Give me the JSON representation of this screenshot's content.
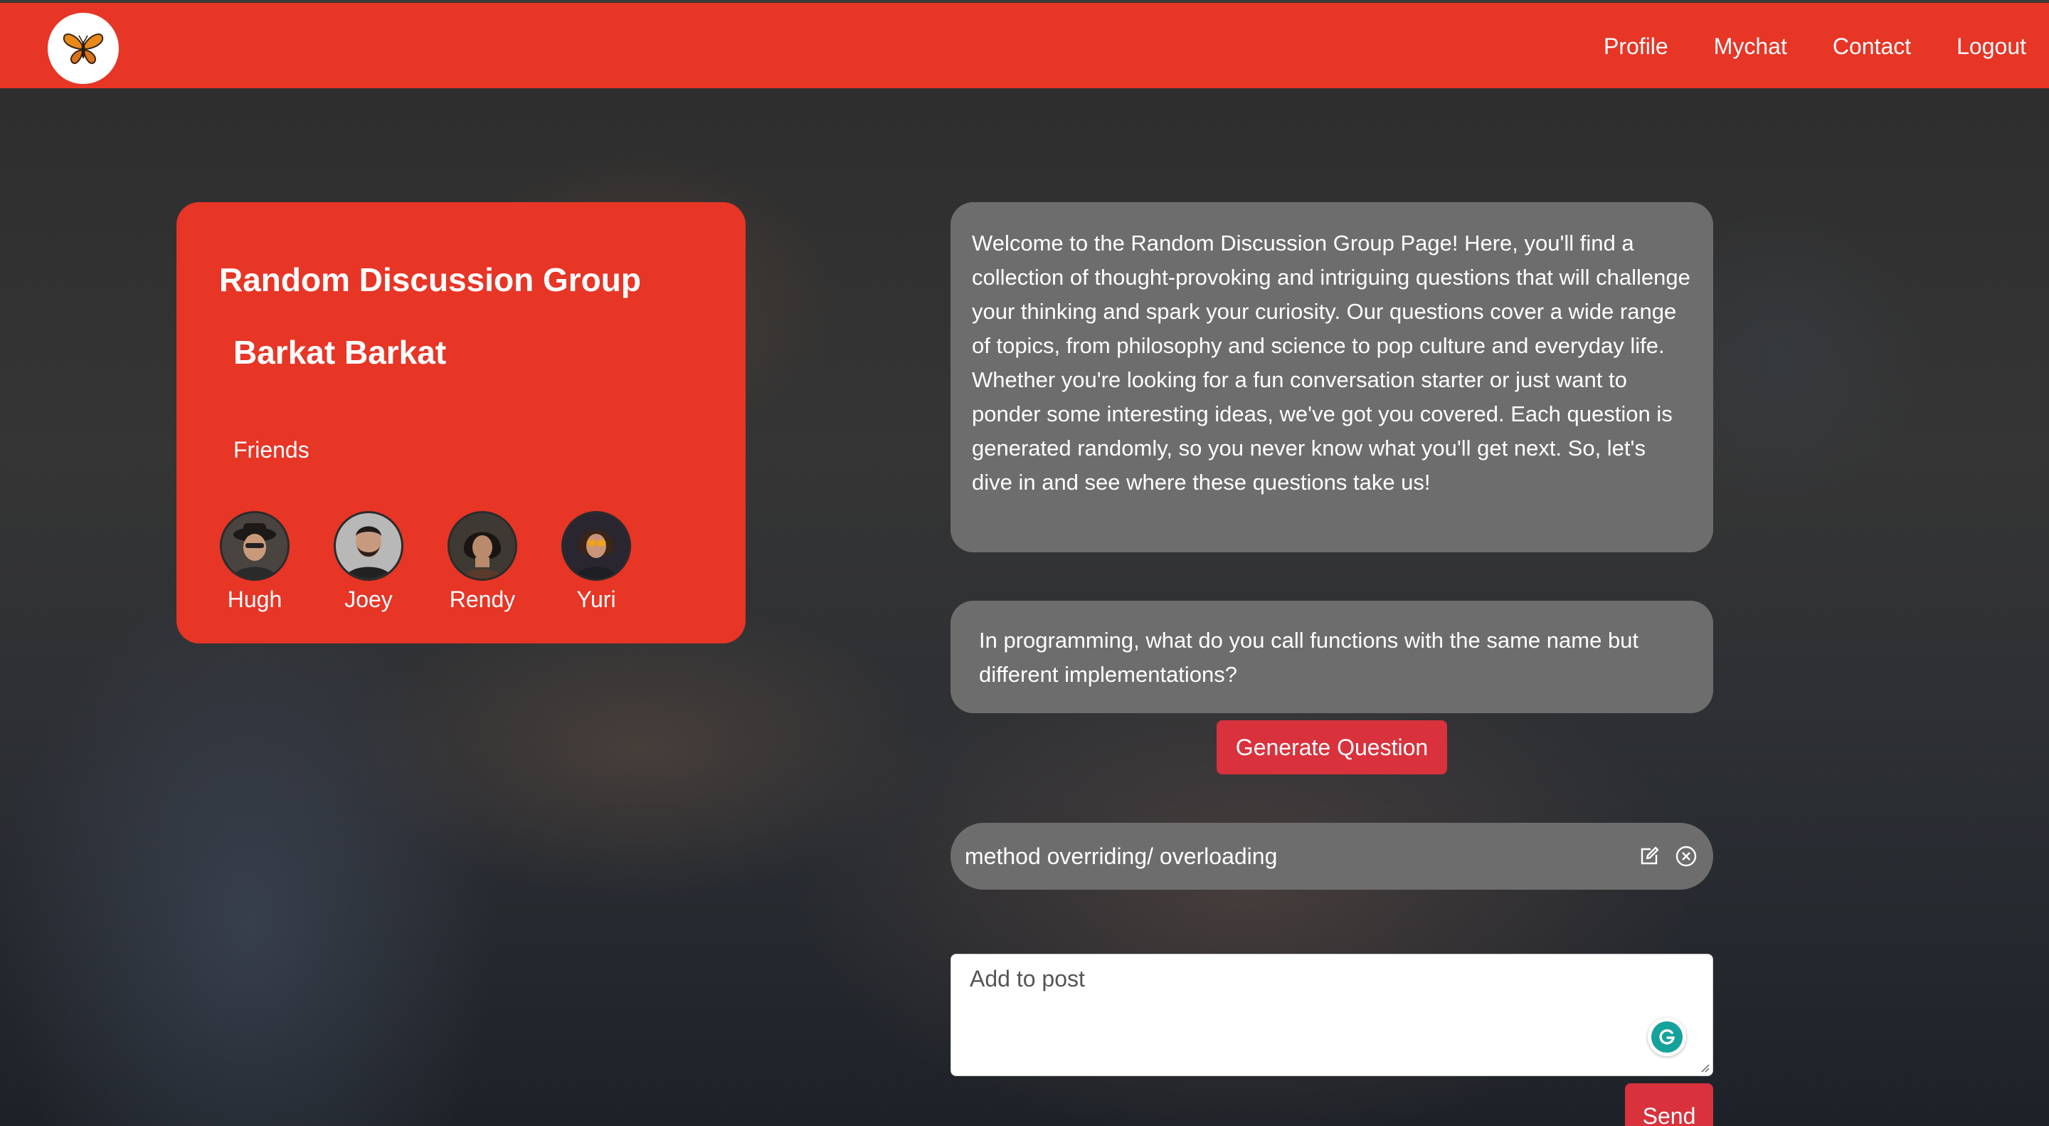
{
  "nav": {
    "logo_icon": "butterfly-icon",
    "links": [
      "Profile",
      "Mychat",
      "Contact",
      "Logout"
    ]
  },
  "group": {
    "title": "Random Discussion Group",
    "user_name": "Barkat Barkat",
    "friends_label": "Friends",
    "friends": [
      "Hugh",
      "Joey",
      "Rendy",
      "Yuri"
    ]
  },
  "intro_text": "Welcome to the Random Discussion Group Page! Here, you'll find a collection of thought-provoking and intriguing questions that will challenge your thinking and spark your curiosity. Our questions cover a wide range of topics, from philosophy and science to pop culture and everyday life. Whether you're looking for a fun conversation starter or just want to ponder some interesting ideas, we've got you covered. Each question is generated randomly, so you never know what you'll get next. So, let's dive in and see where these questions take us!",
  "question": "In programming, what do you call functions with the same name but different implementations?",
  "generate_label": "Generate Question",
  "answer": {
    "text": "method overriding/ overloading",
    "edit_icon": "edit-icon",
    "delete_icon": "close-circle-icon"
  },
  "post": {
    "placeholder": "Add to post",
    "send_label": "Send"
  },
  "colors": {
    "brand_red": "#e73526",
    "button_red": "#d9323d",
    "bubble_gray": "#6d6d6d"
  }
}
